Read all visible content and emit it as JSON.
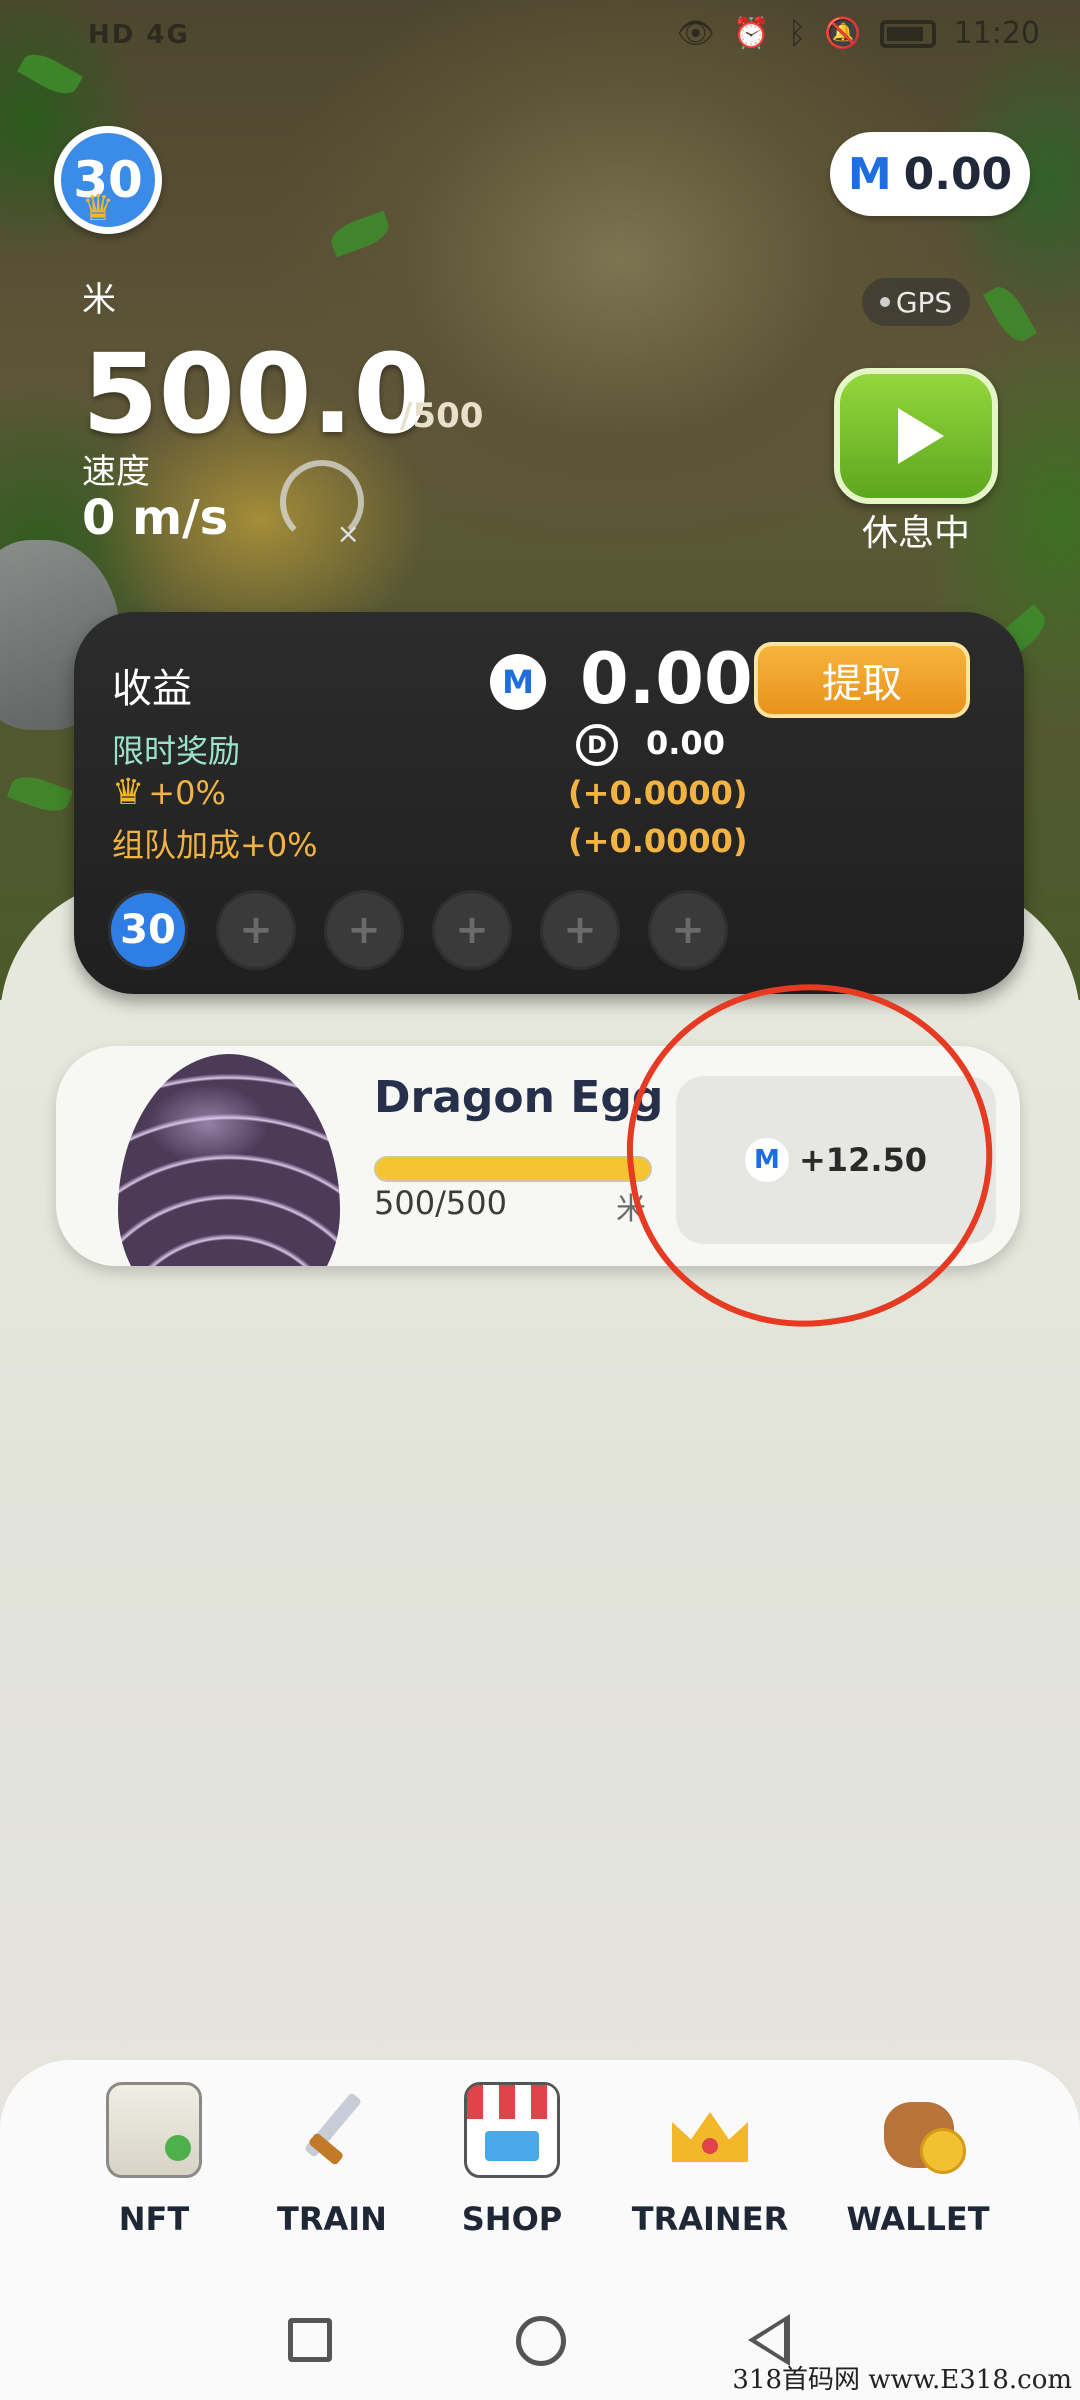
{
  "status_bar": {
    "left": "HD 4G",
    "time": "11:20",
    "icons": [
      "eye-icon",
      "alarm-icon",
      "bluetooth-icon",
      "bell-off-icon",
      "battery-icon"
    ]
  },
  "player": {
    "level": "30",
    "unit_label": "米",
    "distance": "500.0",
    "distance_max": "/500",
    "speed_label": "速度",
    "speed_value": "0 m/s"
  },
  "balance": {
    "icon": "m-token-icon",
    "value": "0.00"
  },
  "gps_label": "GPS",
  "play": {
    "status_label": "休息中"
  },
  "earnings": {
    "title": "收益",
    "value": "0.00",
    "withdraw_label": "提取",
    "limited_bonus_label": "限时奖励",
    "d_value": "0.00",
    "crown_pct": "+0%",
    "crown_add": "(+0.0000)",
    "team_label": "组队加成+0%",
    "team_add": "(+0.0000)",
    "slots": [
      "30",
      "+",
      "+",
      "+",
      "+",
      "+"
    ]
  },
  "egg": {
    "name": "Dragon Egg",
    "progress_text": "500/500",
    "progress_fraction": 1.0,
    "unit": "米",
    "reward": "+12.50"
  },
  "nav": {
    "items": [
      {
        "label": "NFT",
        "icon": "certificate-icon"
      },
      {
        "label": "TRAIN",
        "icon": "sword-icon"
      },
      {
        "label": "SHOP",
        "icon": "shop-icon"
      },
      {
        "label": "TRAINER",
        "icon": "crown-icon"
      },
      {
        "label": "WALLET",
        "icon": "money-bag-icon"
      }
    ]
  },
  "watermark": "318首码网 www.E318.com",
  "colors": {
    "accent_blue": "#2f7ee6",
    "gold": "#f2b342",
    "green_button": "#5da71f",
    "annotation_red": "#e63a22"
  }
}
